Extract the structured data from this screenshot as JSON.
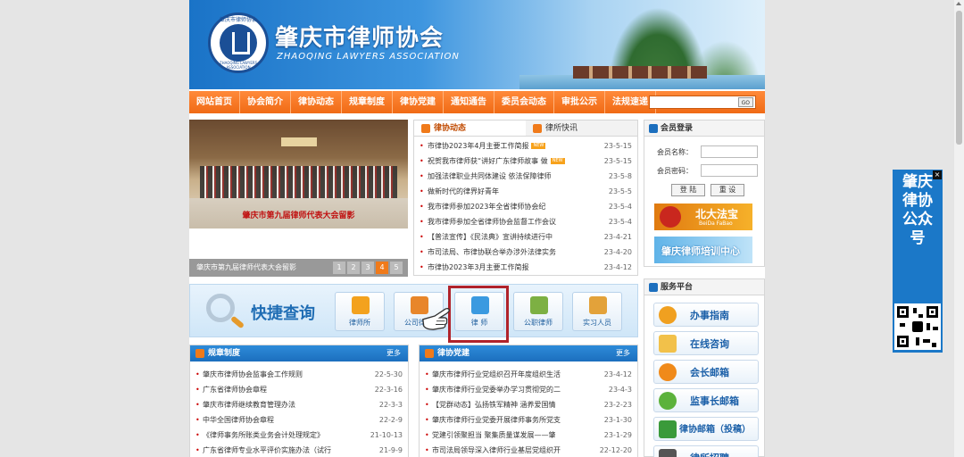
{
  "header": {
    "title": "肇庆市律师协会",
    "subtitle": "ZHAOQING LAWYERS ASSOCIATION",
    "seal_cn": "肇庆市律师协会",
    "seal_en": "ZHAOQING LAWYERS ASSOCIATION"
  },
  "nav": {
    "items": [
      "网站首页",
      "协会简介",
      "律协动态",
      "规章制度",
      "律协党建",
      "通知通告",
      "委员会动态",
      "审批公示",
      "法规速递"
    ],
    "search_button": "GO"
  },
  "slider": {
    "photo_caption": "肇庆市第九届律师代表大会留影",
    "caption": "肇庆市第九届律师代表大会留影",
    "pages": [
      "1",
      "2",
      "3",
      "4",
      "5"
    ],
    "active_page": "4"
  },
  "news": {
    "tabs": [
      "律协动态",
      "律所快讯"
    ],
    "new_badge": "NEW",
    "items": [
      {
        "title": "市律协2023年4月主要工作简报",
        "date": "23-5-15",
        "new": true
      },
      {
        "title": "祝贺我市律师获“讲好广东律师故事 做",
        "date": "23-5-15",
        "new": true
      },
      {
        "title": "加强法律职业共同体建设 依法保障律师",
        "date": "23-5-8",
        "new": false
      },
      {
        "title": "做新时代的律界好青年",
        "date": "23-5-5",
        "new": false
      },
      {
        "title": "我市律师参加2023年全省律师协会纪",
        "date": "23-5-4",
        "new": false
      },
      {
        "title": "我市律师参加全省律师协会监督工作会议",
        "date": "23-5-4",
        "new": false
      },
      {
        "title": "【普法宣传】《民法典》宣讲持续进行中",
        "date": "23-4-21",
        "new": false
      },
      {
        "title": "市司法局、市律协联合举办涉外法律实务",
        "date": "23-4-20",
        "new": false
      },
      {
        "title": "市律协2023年3月主要工作简报",
        "date": "23-4-12",
        "new": false
      }
    ]
  },
  "quick": {
    "title": "快捷查询",
    "buttons": [
      "律师所",
      "公司律师",
      "律 师",
      "公职律师",
      "实习人员"
    ]
  },
  "rules": {
    "title": "规章制度",
    "more": "更多",
    "items": [
      {
        "title": "肇庆市律师协会监事会工作规则",
        "date": "22-5-30"
      },
      {
        "title": "广东省律师协会章程",
        "date": "22-3-16"
      },
      {
        "title": "肇庆市律师继续教育管理办法",
        "date": "22-3-3"
      },
      {
        "title": "中华全国律师协会章程",
        "date": "22-2-9"
      },
      {
        "title": "《律师事务所账类业务会计处理规定》",
        "date": "21-10-13"
      },
      {
        "title": "广东省律师专业水平评价实施办法（试行",
        "date": "21-9-9"
      }
    ]
  },
  "party": {
    "title": "律协党建",
    "more": "更多",
    "items": [
      {
        "title": "肇庆市律师行业党组织召开年度组织生活",
        "date": "23-4-12"
      },
      {
        "title": "肇庆市律师行业党委举办学习贯彻党的二",
        "date": "23-4-3"
      },
      {
        "title": "【党群动态】弘扬铁军精神 涵养爱国情",
        "date": "23-2-23"
      },
      {
        "title": "肇庆市律师行业党委开展律师事务所党支",
        "date": "23-1-30"
      },
      {
        "title": "党建引领聚担当 聚集质量谋发展——肇",
        "date": "23-1-29"
      },
      {
        "title": "市司法局领导深入律师行业基层党组织开",
        "date": "22-12-20"
      }
    ]
  },
  "login": {
    "title": "会员登录",
    "username_label": "会员名称：",
    "password_label": "会员密码：",
    "login_button": "登 陆",
    "reset_button": "重 设",
    "ad1_title": "北大法宝",
    "ad1_sub": "BeiDa FaBao",
    "ad2_title": "肇庆律师培训中心"
  },
  "service": {
    "title": "服务平台",
    "items": [
      "办事指南",
      "在线咨询",
      "会长邮箱",
      "监事长邮箱",
      "律协邮箱（投稿）",
      "律所招聘"
    ]
  },
  "float_widget": {
    "text": "肇庆律协公众号",
    "close": "×"
  },
  "colors": {
    "nav_orange": "#f06a15",
    "primary_blue": "#1c6fbe",
    "highlight_red": "#b0232b"
  }
}
